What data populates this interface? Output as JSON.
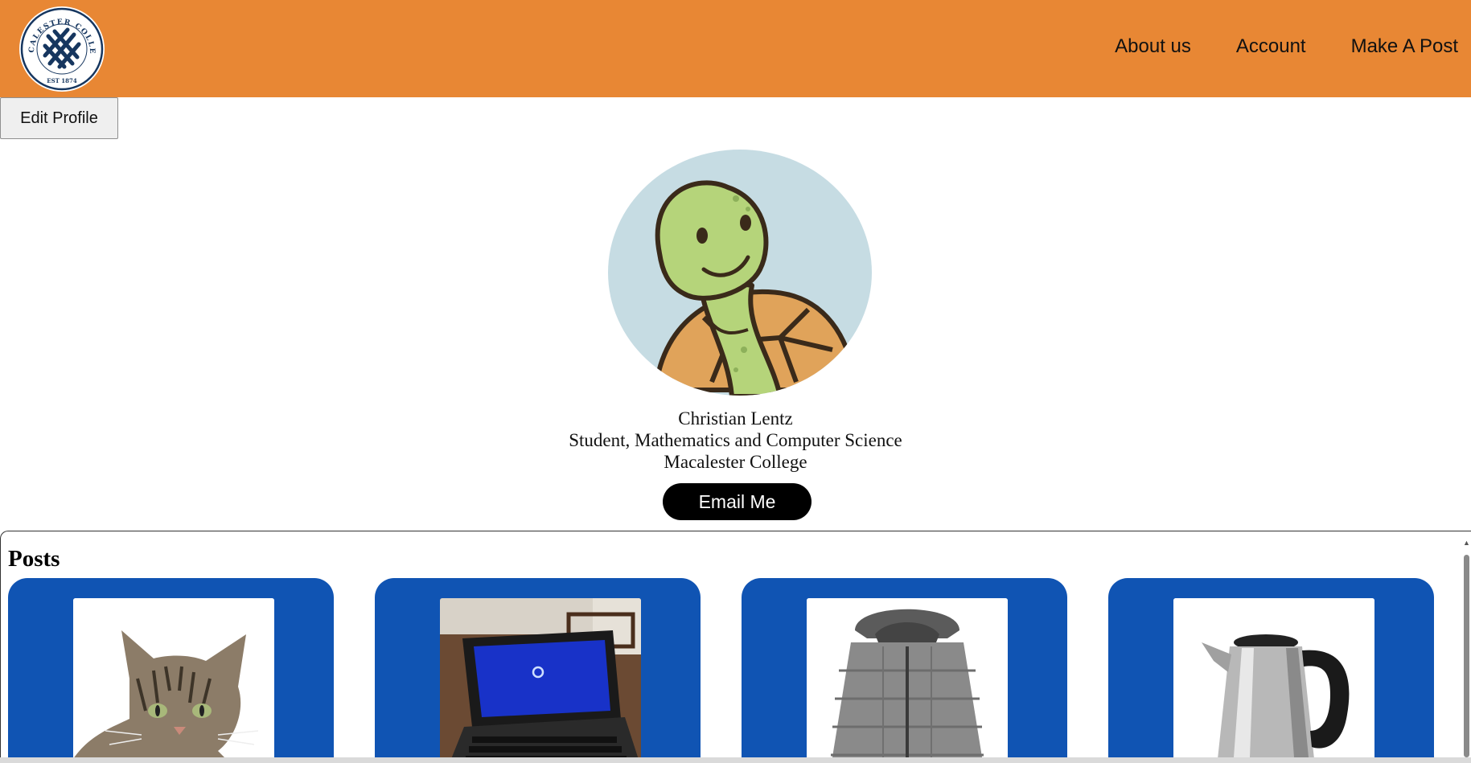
{
  "header": {
    "logo": {
      "ring_text": "MACALESTER COLLEGE",
      "est_text": "EST 1874",
      "icon": "macalester-college-seal-icon"
    },
    "nav": [
      {
        "label": "About us"
      },
      {
        "label": "Account"
      },
      {
        "label": "Make A Post"
      }
    ]
  },
  "profile": {
    "edit_button": "Edit Profile",
    "avatar_icon": "turtle-avatar",
    "name": "Christian Lentz",
    "role": "Student, Mathematics and Computer Science",
    "school": "Macalester College",
    "email_button": "Email Me"
  },
  "posts": {
    "title": "Posts",
    "items": [
      {
        "image": "cat-photo"
      },
      {
        "image": "laptop-photo"
      },
      {
        "image": "winter-jacket-photo"
      },
      {
        "image": "electric-kettle-photo"
      }
    ]
  },
  "colors": {
    "header": "#e88734",
    "card": "#1054b3",
    "email_button": "#000000",
    "seal": "#16365f"
  }
}
